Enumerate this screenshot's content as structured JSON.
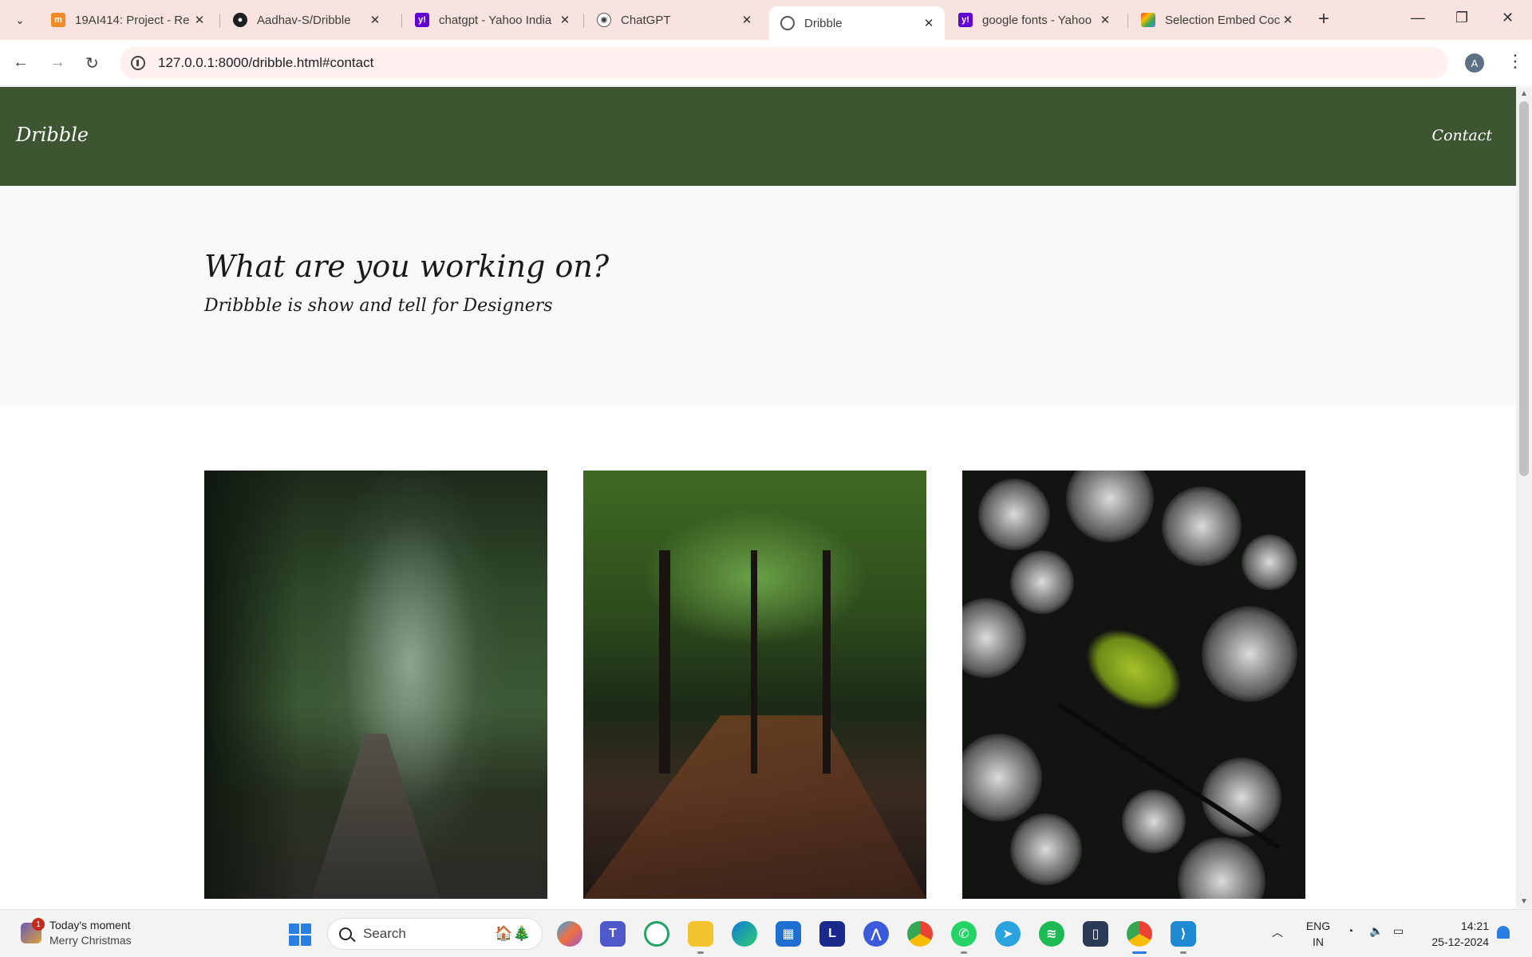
{
  "browser": {
    "tabs": [
      {
        "title": "19AI414: Project - Re",
        "favicon": "moodle-icon",
        "active": false
      },
      {
        "title": "Aadhav-S/Dribble",
        "favicon": "github-icon",
        "active": false
      },
      {
        "title": "chatgpt - Yahoo India",
        "favicon": "yahoo-icon",
        "active": false
      },
      {
        "title": "ChatGPT",
        "favicon": "chatgpt-icon",
        "active": false
      },
      {
        "title": "Dribble",
        "favicon": "globe-icon",
        "active": true
      },
      {
        "title": "google fonts - Yahoo",
        "favicon": "yahoo-icon",
        "active": false
      },
      {
        "title": "Selection Embed Coc",
        "favicon": "google-fonts-icon",
        "active": false
      }
    ],
    "url": "127.0.0.1:8000/dribble.html#contact",
    "profile_initial": "A"
  },
  "page": {
    "brand": "Dribble",
    "nav_contact": "Contact",
    "hero_title": "What are you working on?",
    "hero_subtitle": "Dribbble is show and tell for Designers",
    "gallery": [
      {
        "name": "misty-forest-path-photo"
      },
      {
        "name": "autumn-leaf-path-photo"
      },
      {
        "name": "moss-branch-bokeh-photo"
      }
    ]
  },
  "taskbar": {
    "widget_badge": "1",
    "widget_title": "Today's moment",
    "widget_subtitle": "Merry Christmas",
    "search_label": "Search",
    "language_line1": "ENG",
    "language_line2": "IN",
    "time": "14:21",
    "date": "25-12-2024",
    "apps": [
      "copilot-icon",
      "teams-icon",
      "cortana-icon",
      "file-explorer-icon",
      "edge-icon",
      "store-icon",
      "l-app-icon",
      "affinity-icon",
      "chrome-icon",
      "whatsapp-icon",
      "telegram-icon",
      "spotify-icon",
      "phone-link-icon",
      "chrome-profile-icon",
      "vscode-icon"
    ]
  },
  "colors": {
    "header_green": "#3e5532",
    "tabbar": "#f8e3e1",
    "hero_bg": "#f7f9fa"
  }
}
